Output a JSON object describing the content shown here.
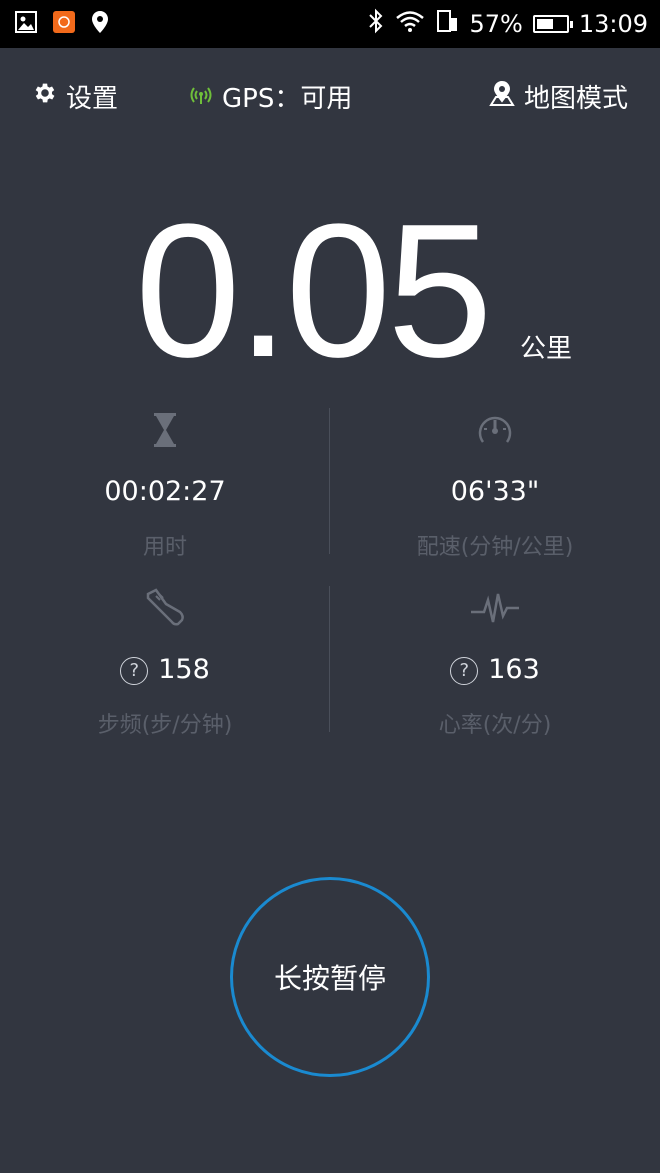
{
  "status_bar": {
    "battery": "57%",
    "battery_level": 0.57,
    "time": "13:09"
  },
  "header": {
    "settings_label": "设置",
    "gps_label": "GPS：可用",
    "map_mode_label": "地图模式"
  },
  "distance": {
    "value": "0.05",
    "unit": "公里"
  },
  "metrics": {
    "duration": {
      "value": "00:02:27",
      "label": "用时"
    },
    "pace": {
      "value": "06'33\"",
      "label": "配速(分钟/公里)"
    },
    "cadence": {
      "value": "158",
      "label": "步频(步/分钟)"
    },
    "heart_rate": {
      "value": "163",
      "label": "心率(次/分)"
    }
  },
  "pause_button": {
    "label": "长按暂停"
  },
  "colors": {
    "background": "#323640",
    "accent_ring": "#1a8ad0",
    "gps_ok": "#6fbf3a"
  }
}
